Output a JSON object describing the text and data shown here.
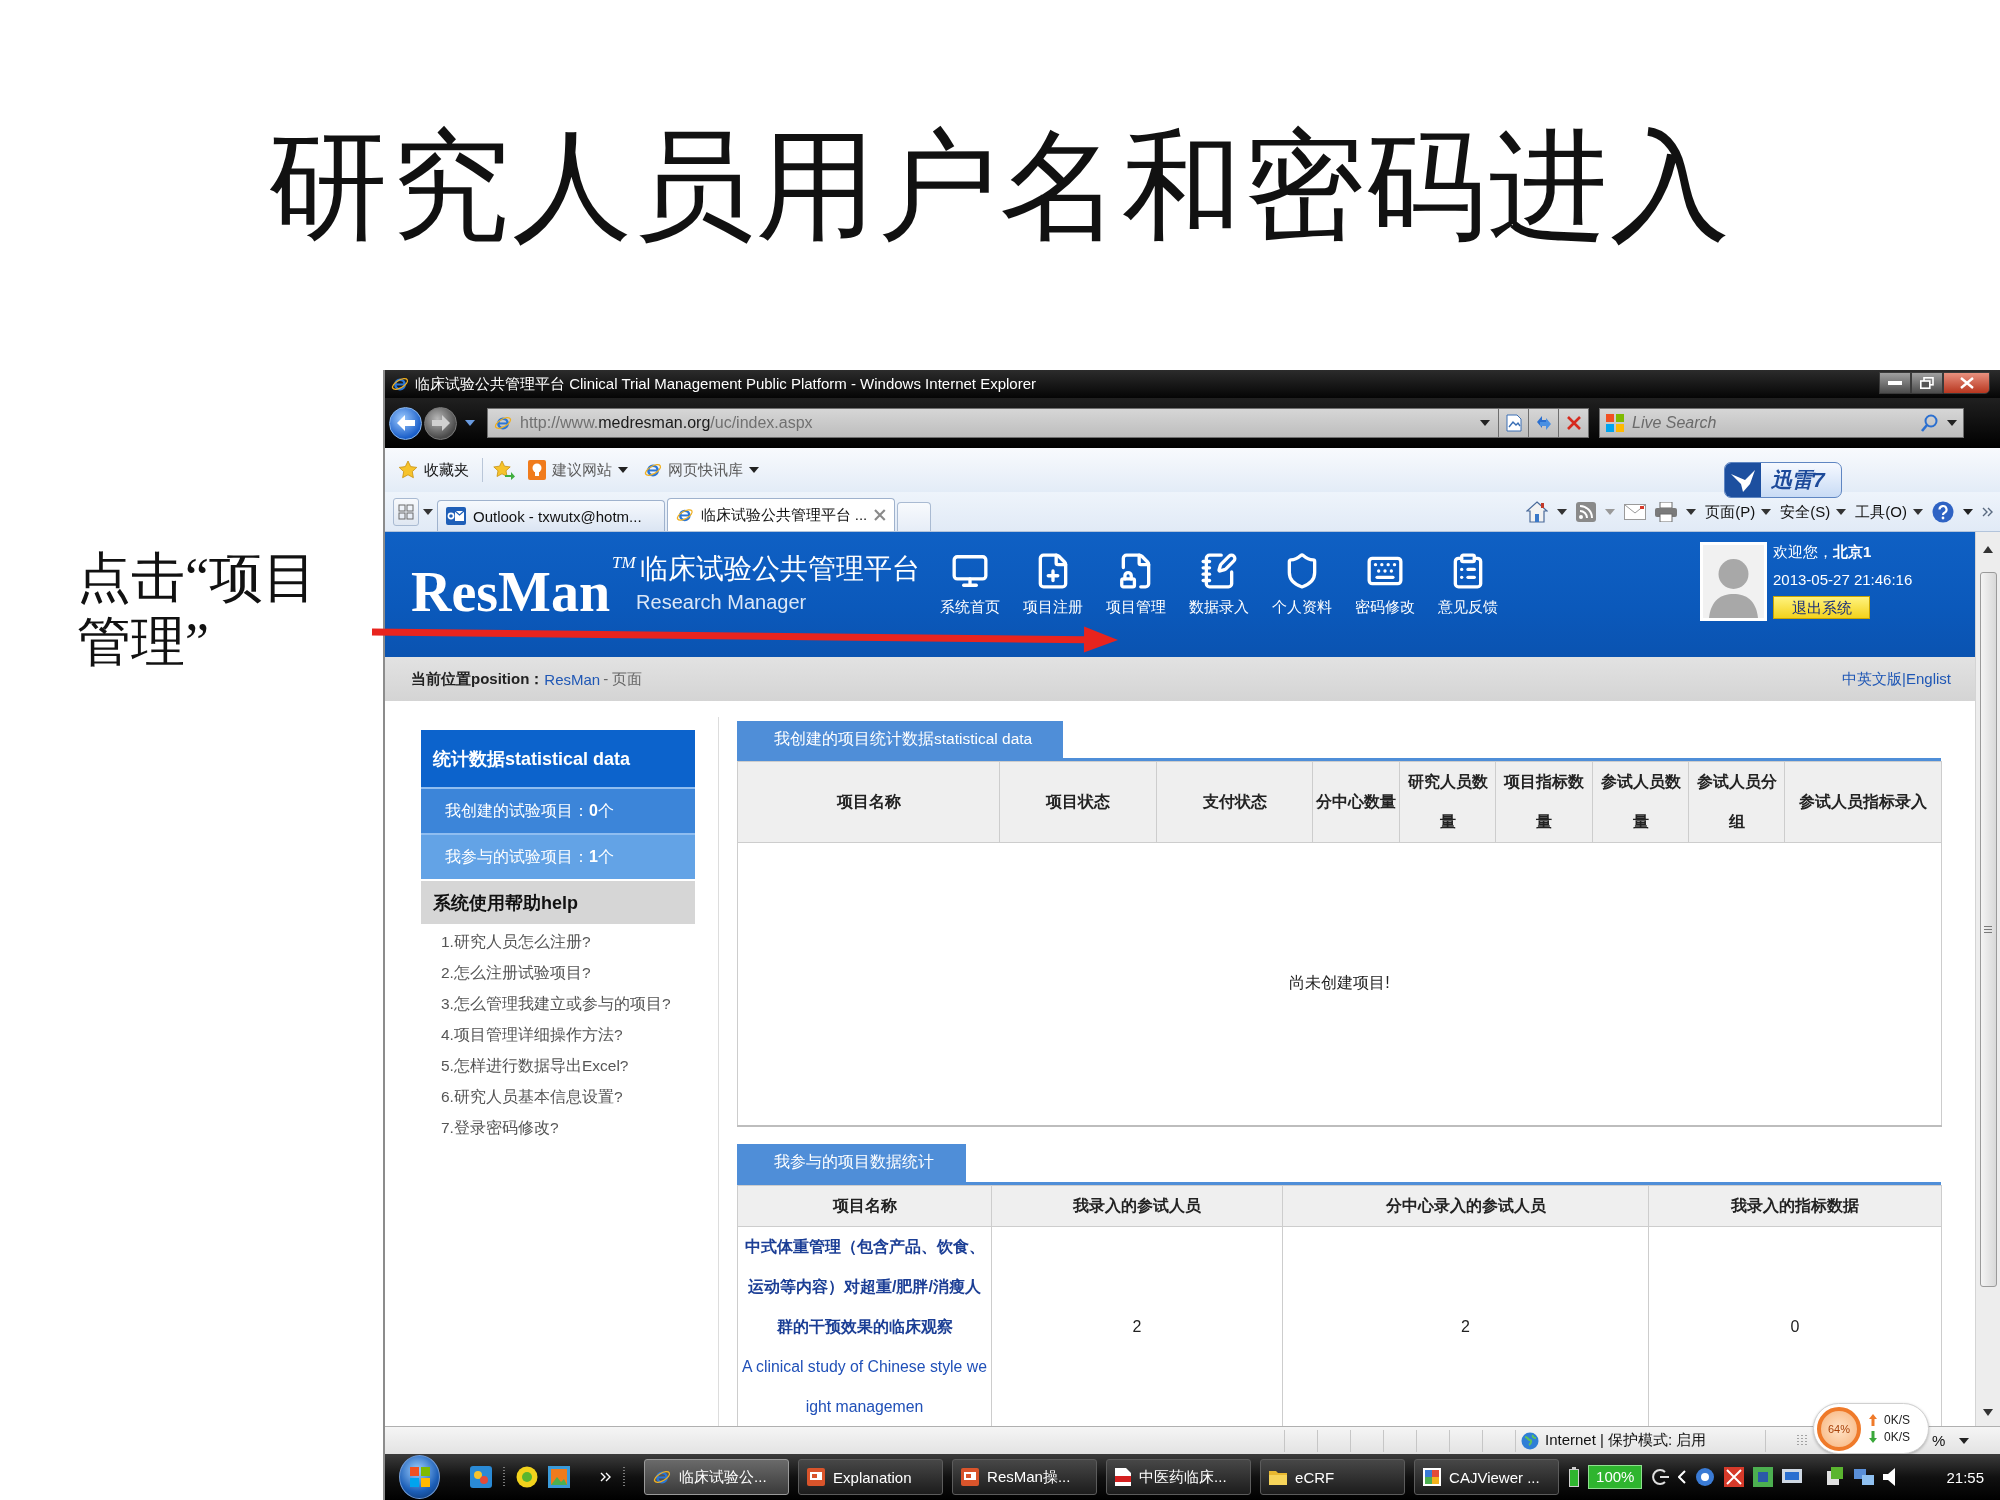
{
  "slide": {
    "title": "研究人员用户名和密码进入",
    "annotation": "点击“项目管理”"
  },
  "browser": {
    "title": "临床试验公共管理平台 Clinical Trial Management Public Platform - Windows Internet Explorer",
    "address": {
      "scheme": "http://www.",
      "domain": "medresman.org",
      "path": "/uc/index.aspx"
    },
    "search": {
      "placeholder": "Live Search"
    },
    "favorites_bar": [
      {
        "label": "收藏夹",
        "kind": "favorites"
      },
      {
        "label": "建议网站",
        "kind": "suggested"
      },
      {
        "label": "网页快讯库",
        "kind": "slices"
      }
    ],
    "tabs": [
      {
        "label": "Outlook - txwutx@hotm...",
        "kind": "mail",
        "selected": false
      },
      {
        "label": "临床试验公共管理平台 ...",
        "kind": "web",
        "selected": true
      }
    ],
    "commands": [
      "页面(P)",
      "安全(S)",
      "工具(O)"
    ],
    "badge": "迅雷7",
    "status_bar": {
      "zone": "Internet | 保护模式: 启用",
      "zoom": "%"
    },
    "speed_widget": {
      "usage": "64%",
      "upload": "0K/S",
      "download": "0K/S"
    }
  },
  "page": {
    "header": {
      "logo": "ResMan",
      "trademark": "TM",
      "title": "临床试验公共管理平台",
      "subtitle": "Research Manager",
      "nav": [
        {
          "label": "系统首页",
          "kind": "monitor"
        },
        {
          "label": "项目注册",
          "kind": "doc-plus"
        },
        {
          "label": "项目管理",
          "kind": "doc-lock"
        },
        {
          "label": "数据录入",
          "kind": "notepad-pen"
        },
        {
          "label": "个人资料",
          "kind": "shield"
        },
        {
          "label": "密码修改",
          "kind": "keyboard"
        },
        {
          "label": "意见反馈",
          "kind": "notepad"
        }
      ],
      "user": {
        "greeting": "欢迎您，**北京1**",
        "datetime": "2013-05-27 21:46:16",
        "logout": "退出系统"
      }
    },
    "breadcrumb": {
      "label": "当前位置position：",
      "link": "ResMan",
      "current": "- 页面",
      "language": "中英文版|Englist"
    },
    "sidebar": {
      "stats_title": "统计数据statistical data",
      "stats": [
        {
          "text": "我创建的试验项目：**0**个",
          "selected": false
        },
        {
          "text": "我参与的试验项目：**1**个",
          "selected": true
        }
      ],
      "help_title": "系统使用帮助help",
      "help_links": [
        "1.研究人员怎么注册?",
        "2.怎么注册试验项目?",
        "3.怎么管理我建立或参与的项目?",
        "4.项目管理详细操作方法?",
        "5.怎样进行数据导出Excel?",
        "6.研究人员基本信息设置?",
        "7.登录密码修改?"
      ]
    },
    "created_projects": {
      "tab": "我创建的项目统计数据statistical data",
      "columns": [
        "项目名称",
        "项目状态",
        "支付状态",
        "分中心数量",
        "研究人员数量",
        "项目指标数量",
        "参试人员数量",
        "参试人员分组",
        "参试人员指标录入"
      ],
      "empty_message": "尚未创建项目!"
    },
    "joined_projects": {
      "tab": "我参与的项目数据统计",
      "columns": [
        "项目名称",
        "我录入的参试人员",
        "分中心录入的参试人员",
        "我录入的指标数据"
      ],
      "rows": [
        {
          "title": "中式体重管理（包含产品、饮食、运动等内容）对超重/肥胖/消瘦人群的干预效果的临床观察",
          "english_title": "A clinical study of Chinese style weight managemen",
          "values": [
            "2",
            "2",
            "0"
          ]
        }
      ]
    }
  },
  "taskbar": {
    "buttons": [
      {
        "label": "临床试验公...",
        "kind": "web",
        "selected": true
      },
      {
        "label": "Explanation",
        "kind": "slides",
        "selected": false
      },
      {
        "label": "ResMan操...",
        "kind": "slides",
        "selected": false
      },
      {
        "label": "中医药临床...",
        "kind": "pdf",
        "selected": false
      },
      {
        "label": "eCRF",
        "kind": "folder",
        "selected": false
      },
      {
        "label": "CAJViewer ...",
        "kind": "viewer",
        "selected": false
      }
    ],
    "battery": "100%",
    "clock": "21:55"
  }
}
